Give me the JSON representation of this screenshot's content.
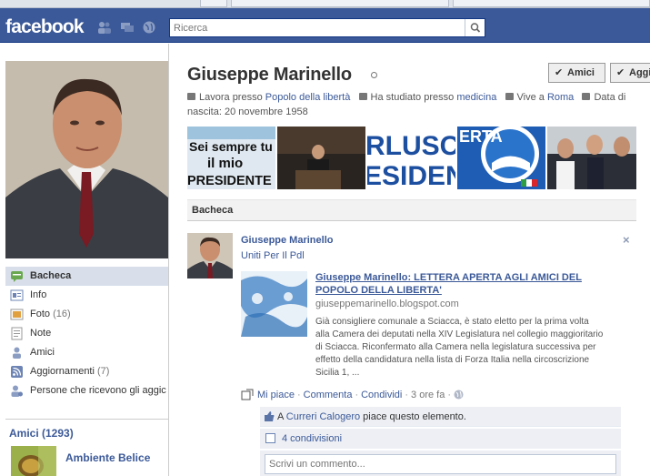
{
  "header": {
    "logo": "facebook",
    "search": {
      "placeholder": "",
      "value": "Ricerca"
    }
  },
  "profile": {
    "name": "Giuseppe Marinello",
    "buttons": {
      "friends": "Amici",
      "add": "Aggi"
    },
    "info": {
      "work_prefix": "Lavora presso",
      "work_link": "Popolo della libertà",
      "study_prefix": "Ha studiato presso",
      "study_link": "medicina",
      "live_prefix": "Vive a",
      "live_link": "Roma",
      "birth": "Data di nascita: 20 novembre 1958"
    },
    "photo_strip": {
      "p1_line1": "Sei sempre tu",
      "p1_line2": "il mio",
      "p1_line3": "PRESIDENTE",
      "p3_line1": "RLUSCO",
      "p3_line2": "ESIDEN",
      "p4_line1": "ERTA"
    }
  },
  "left_nav": {
    "items": [
      {
        "label": "Bacheca",
        "count": ""
      },
      {
        "label": "Info",
        "count": ""
      },
      {
        "label": "Foto",
        "count": "(16)"
      },
      {
        "label": "Note",
        "count": ""
      },
      {
        "label": "Amici",
        "count": ""
      },
      {
        "label": "Aggiornamenti",
        "count": "(7)"
      },
      {
        "label": "Persone che ricevono gli aggic",
        "count": ""
      }
    ],
    "friends_header": "Amici (1293)",
    "friend_name": "Ambiente Belice"
  },
  "wall": {
    "tab_label": "Bacheca",
    "story": {
      "author": "Giuseppe Marinello",
      "text": "Uniti Per Il Pdl",
      "close": "×",
      "attachment": {
        "title": "Giuseppe Marinello: LETTERA APERTA AGLI AMICI DEL POPOLO DELLA LIBERTA'",
        "url": "giuseppemarinello.blogspot.com",
        "description": "Già consigliere comunale a Sciacca, è stato eletto per la prima volta alla Camera dei deputati nella XIV Legislatura nel collegio maggioritario di Sciacca. Riconfermato alla Camera nella legislatura successiva per effetto della candidatura nella lista di Forza Italia nella circoscrizione Sicilia 1, ..."
      },
      "actions": {
        "like": "Mi piace",
        "comment": "Commenta",
        "share": "Condividi",
        "time": "3 ore fa"
      },
      "likes": {
        "prefix": "A",
        "name": "Curreri Calogero",
        "suffix": "piace questo elemento."
      },
      "shares": "4 condivisioni",
      "comment_placeholder": "Scrivi un commento..."
    }
  },
  "colors": {
    "brand_blue": "#3b5998",
    "nav_active": "#d8dfea",
    "ufi_bg": "#edeff4"
  }
}
